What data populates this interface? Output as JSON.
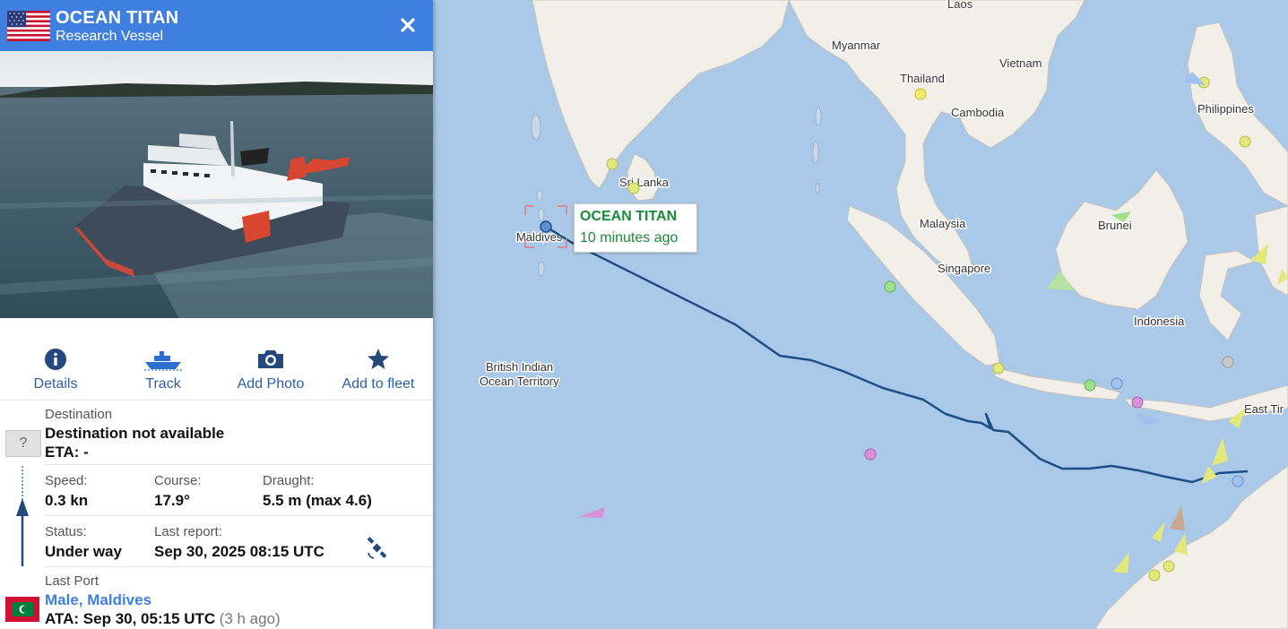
{
  "vessel": {
    "name": "OCEAN TITAN",
    "type": "Research Vessel",
    "flag_icon": "us-flag-icon"
  },
  "actions": [
    {
      "label": "Details",
      "icon": "info-icon"
    },
    {
      "label": "Track",
      "icon": "ship-icon"
    },
    {
      "label": "Add Photo",
      "icon": "camera-icon"
    },
    {
      "label": "Add to fleet",
      "icon": "star-icon"
    }
  ],
  "destination": {
    "label": "Destination",
    "value": "Destination not available",
    "eta": "ETA: -",
    "badge": "?"
  },
  "stats": {
    "speed_label": "Speed:",
    "speed": "0.3 kn",
    "course_label": "Course:",
    "course": "17.9°",
    "draught_label": "Draught:",
    "draught": "5.5 m (max 4.6)",
    "status_label": "Status:",
    "status": "Under way",
    "last_report_label": "Last report:",
    "last_report": "Sep 30, 2025 08:15 UTC"
  },
  "last_port": {
    "label": "Last Port",
    "name": "Male, Maldives",
    "ata": "ATA: Sep 30, 05:15 UTC",
    "ago": "(3 h ago)",
    "flag_icon": "maldives-flag-icon"
  },
  "map": {
    "tooltip_name": "OCEAN TITAN",
    "tooltip_time": "10 minutes ago",
    "labels": {
      "laos": "Laos",
      "myanmar": "Myanmar",
      "vietnam": "Vietnam",
      "thailand": "Thailand",
      "cambodia": "Cambodia",
      "philippines": "Philippines",
      "sri_lanka": "Sri Lanka",
      "maldives": "Maldives",
      "malaysia": "Malaysia",
      "brunei": "Brunei",
      "singapore": "Singapore",
      "indonesia": "Indonesia",
      "biot_1": "British Indian",
      "biot_2": "Ocean Territory",
      "east_timor": "East Tir"
    },
    "colors": {
      "sea": "#aac8e8",
      "land": "#f2efe9",
      "track": "#1b4f86"
    }
  }
}
